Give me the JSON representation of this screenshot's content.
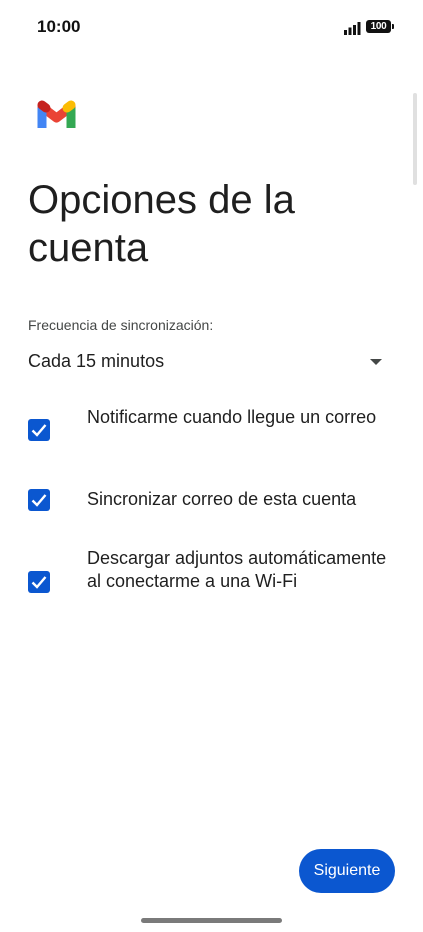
{
  "status_bar": {
    "time": "10:00",
    "battery": "100"
  },
  "app": {
    "logo_icon": "gmail-m-icon"
  },
  "page": {
    "title": "Opciones de la cuenta"
  },
  "sync": {
    "label": "Frecuencia de sincronización:",
    "selected": "Cada 15 minutos"
  },
  "options": [
    {
      "label": "Notificarme cuando llegue un correo",
      "checked": true
    },
    {
      "label": "Sincronizar correo de esta cuenta",
      "checked": true
    },
    {
      "label": "Descargar adjuntos automáticamente al conectarme a una Wi-Fi",
      "checked": true
    }
  ],
  "actions": {
    "next_label": "Siguiente"
  },
  "colors": {
    "accent": "#0b57d0",
    "text": "#1f1f1f",
    "secondary_text": "#444746",
    "background": "#ffffff"
  }
}
